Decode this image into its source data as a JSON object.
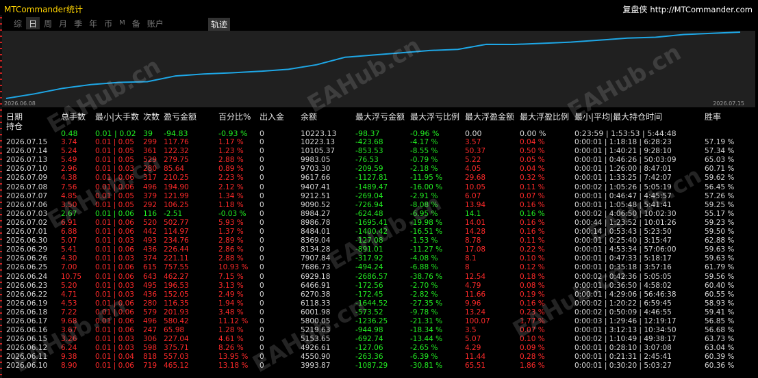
{
  "header": {
    "app_title": "MTCommander统计",
    "site_cn": "复盘侠",
    "site_url": "http://MTCommander.com"
  },
  "tabs": [
    {
      "label": "综",
      "active": false
    },
    {
      "label": "日",
      "active": true
    },
    {
      "label": "周",
      "active": false
    },
    {
      "label": "月",
      "active": false
    },
    {
      "label": "季",
      "active": false
    },
    {
      "label": "年",
      "active": false
    },
    {
      "label": "币",
      "active": false
    },
    {
      "label": "M",
      "active": false
    },
    {
      "label": "备",
      "active": false
    },
    {
      "label": "账户",
      "active": false
    }
  ],
  "track_button": "轨迹",
  "chart": {
    "start_date": "2026.06.08",
    "end_date": "2026.07.15",
    "line_color": "#1ea7e6"
  },
  "table": {
    "headers": {
      "date": "日期",
      "holding": "持仓",
      "total_lots": "总手数",
      "min_max_lots": "最小|大手数",
      "count": "次数",
      "pnl": "盈亏金额",
      "pct": "百分比%",
      "in_out": "出入金",
      "balance": "余额",
      "max_float_loss_amt": "最大浮亏金额",
      "max_float_loss_pct": "最大浮亏比例",
      "max_float_profit_amt": "最大浮盈金额",
      "max_float_profit_pct": "最大浮盈比例",
      "hold_time": "最小|平均|最大持仓时间",
      "win_rate": "胜率"
    },
    "holding_row": {
      "total": "0.48",
      "minmax": "0.01 | 0.02",
      "count": "39",
      "pnl": "-94.83",
      "pct": "-0.93 %",
      "io": "0",
      "balance": "10223.13",
      "maxlossamt": "-98.37",
      "maxlosspct": "-0.96 %",
      "maxprofamt": "0.00",
      "maxprofpct": "0.00 %",
      "hold": "0:23:59 | 1:53:53 | 5:44:48",
      "win": ""
    },
    "rows": [
      {
        "date": "2026.07.15",
        "total": "3.74",
        "minmax": "0.01 | 0.05",
        "count": "299",
        "pnl": "117.76",
        "pct": "1.17 %",
        "io": "0",
        "balance": "10223.13",
        "maxlossamt": "-423.68",
        "maxlosspct": "-4.17 %",
        "maxprofamt": "3.57",
        "maxprofpct": "0.04 %",
        "hold": "0:00:01 | 1:18:18 | 6:28:23",
        "win": "57.19 %"
      },
      {
        "date": "2026.07.14",
        "total": "5.24",
        "minmax": "0.01 | 0.05",
        "count": "361",
        "pnl": "122.32",
        "pct": "1.23 %",
        "io": "0",
        "balance": "10105.37",
        "maxlossamt": "-853.53",
        "maxlosspct": "-8.55 %",
        "maxprofamt": "50.37",
        "maxprofpct": "0.50 %",
        "hold": "0:00:01 | 1:40:21 | 9:28:10",
        "win": "57.34 %"
      },
      {
        "date": "2026.07.13",
        "total": "5.49",
        "minmax": "0.01 | 0.05",
        "count": "529",
        "pnl": "279.75",
        "pct": "2.88 %",
        "io": "0",
        "balance": "9983.05",
        "maxlossamt": "-76.53",
        "maxlosspct": "-0.79 %",
        "maxprofamt": "5.22",
        "maxprofpct": "0.05 %",
        "hold": "0:00:01 | 0:46:26 | 50:03:09",
        "win": "65.03 %"
      },
      {
        "date": "2026.07.10",
        "total": "2.96",
        "minmax": "0.01 | 0.03",
        "count": "280",
        "pnl": "85.64",
        "pct": "0.89 %",
        "io": "0",
        "balance": "9703.30",
        "maxlossamt": "-209.59",
        "maxlosspct": "-2.18 %",
        "maxprofamt": "4.05",
        "maxprofpct": "0.04 %",
        "hold": "0:00:01 | 1:26:00 | 8:47:01",
        "win": "60.71 %"
      },
      {
        "date": "2026.07.09",
        "total": "4.38",
        "minmax": "0.01 | 0.06",
        "count": "317",
        "pnl": "210.25",
        "pct": "2.23 %",
        "io": "0",
        "balance": "9617.66",
        "maxlossamt": "-1127.81",
        "maxlosspct": "-11.95 %",
        "maxprofamt": "29.68",
        "maxprofpct": "0.32 %",
        "hold": "0:00:01 | 1:33:25 | 7:42:07",
        "win": "59.62 %"
      },
      {
        "date": "2026.07.08",
        "total": "7.56",
        "minmax": "0.01 | 0.06",
        "count": "496",
        "pnl": "194.90",
        "pct": "2.12 %",
        "io": "0",
        "balance": "9407.41",
        "maxlossamt": "-1489.47",
        "maxlosspct": "-16.00 %",
        "maxprofamt": "10.05",
        "maxprofpct": "0.11 %",
        "hold": "0:00:02 | 1:05:26 | 5:05:19",
        "win": "56.45 %"
      },
      {
        "date": "2026.07.07",
        "total": "4.85",
        "minmax": "0.01 | 0.05",
        "count": "379",
        "pnl": "121.99",
        "pct": "1.34 %",
        "io": "0",
        "balance": "9212.51",
        "maxlossamt": "-269.04",
        "maxlosspct": "-2.91 %",
        "maxprofamt": "6.07",
        "maxprofpct": "0.07 %",
        "hold": "0:00:01 | 0:46:47 | 4:45:57",
        "win": "57.26 %"
      },
      {
        "date": "2026.07.06",
        "total": "3.50",
        "minmax": "0.01 | 0.05",
        "count": "292",
        "pnl": "106.25",
        "pct": "1.18 %",
        "io": "0",
        "balance": "9090.52",
        "maxlossamt": "-726.94",
        "maxlosspct": "-8.08 %",
        "maxprofamt": "13.94",
        "maxprofpct": "0.16 %",
        "hold": "0:00:01 | 1:05:48 | 5:41:41",
        "win": "59.25 %"
      },
      {
        "date": "2026.07.03",
        "total": "2.67",
        "minmax": "0.01 | 0.06",
        "count": "116",
        "pnl": "-2.51",
        "pct": "-0.03 %",
        "io": "0",
        "balance": "8984.27",
        "maxlossamt": "-624.48",
        "maxlosspct": "-6.95 %",
        "maxprofamt": "14.1",
        "maxprofpct": "0.16 %",
        "hold": "0:00:02 | 4:06:50 | 10:02:30",
        "win": "55.17 %"
      },
      {
        "date": "2026.07.02",
        "total": "6.91",
        "minmax": "0.01 | 0.06",
        "count": "520",
        "pnl": "502.77",
        "pct": "5.93 %",
        "io": "0",
        "balance": "8986.78",
        "maxlossamt": "-1695.41",
        "maxlosspct": "-19.98 %",
        "maxprofamt": "14.01",
        "maxprofpct": "0.16 %",
        "hold": "0:00:44 | 1:23:52 | 10:01:26",
        "win": "59.23 %"
      },
      {
        "date": "2026.07.01",
        "total": "6.88",
        "minmax": "0.01 | 0.06",
        "count": "442",
        "pnl": "114.97",
        "pct": "1.37 %",
        "io": "0",
        "balance": "8484.01",
        "maxlossamt": "-1400.42",
        "maxlosspct": "-16.51 %",
        "maxprofamt": "14.28",
        "maxprofpct": "0.16 %",
        "hold": "0:00:14 | 0:53:43 | 5:23:50",
        "win": "59.50 %"
      },
      {
        "date": "2026.06.30",
        "total": "5.07",
        "minmax": "0.01 | 0.03",
        "count": "493",
        "pnl": "234.76",
        "pct": "2.89 %",
        "io": "0",
        "balance": "8369.04",
        "maxlossamt": "-127.08",
        "maxlosspct": "-1.53 %",
        "maxprofamt": "8.78",
        "maxprofpct": "0.11 %",
        "hold": "0:00:01 | 0:25:40 | 3:15:47",
        "win": "62.88 %"
      },
      {
        "date": "2026.06.29",
        "total": "5.41",
        "minmax": "0.01 | 0.06",
        "count": "436",
        "pnl": "226.44",
        "pct": "2.86 %",
        "io": "0",
        "balance": "8134.28",
        "maxlossamt": "-891.01",
        "maxlosspct": "-11.27 %",
        "maxprofamt": "17.08",
        "maxprofpct": "0.22 %",
        "hold": "0:00:01 | 4:53:34 | 57:06:00",
        "win": "59.63 %"
      },
      {
        "date": "2026.06.26",
        "total": "4.30",
        "minmax": "0.01 | 0.03",
        "count": "374",
        "pnl": "221.11",
        "pct": "2.88 %",
        "io": "0",
        "balance": "7907.84",
        "maxlossamt": "-317.92",
        "maxlosspct": "-4.08 %",
        "maxprofamt": "8.1",
        "maxprofpct": "0.10 %",
        "hold": "0:00:01 | 0:47:33 | 5:18:17",
        "win": "59.63 %"
      },
      {
        "date": "2026.06.25",
        "total": "7.00",
        "minmax": "0.01 | 0.06",
        "count": "615",
        "pnl": "757.55",
        "pct": "10.93 %",
        "io": "0",
        "balance": "7686.73",
        "maxlossamt": "-494.24",
        "maxlosspct": "-6.88 %",
        "maxprofamt": "8",
        "maxprofpct": "0.12 %",
        "hold": "0:00:01 | 0:35:18 | 3:57:16",
        "win": "61.79 %"
      },
      {
        "date": "2026.06.24",
        "total": "10.75",
        "minmax": "0.01 | 0.06",
        "count": "643",
        "pnl": "462.27",
        "pct": "7.15 %",
        "io": "0",
        "balance": "6929.18",
        "maxlossamt": "-2686.57",
        "maxlosspct": "-38.76 %",
        "maxprofamt": "12.54",
        "maxprofpct": "0.18 %",
        "hold": "0:00:02 | 0:42:36 | 5:05:05",
        "win": "59.56 %"
      },
      {
        "date": "2026.06.23",
        "total": "5.20",
        "minmax": "0.01 | 0.03",
        "count": "495",
        "pnl": "196.53",
        "pct": "3.13 %",
        "io": "0",
        "balance": "6466.91",
        "maxlossamt": "-172.56",
        "maxlosspct": "-2.70 %",
        "maxprofamt": "4.79",
        "maxprofpct": "0.08 %",
        "hold": "0:00:01 | 0:36:50 | 4:58:02",
        "win": "60.40 %"
      },
      {
        "date": "2026.06.22",
        "total": "4.71",
        "minmax": "0.01 | 0.03",
        "count": "436",
        "pnl": "152.05",
        "pct": "2.49 %",
        "io": "0",
        "balance": "6270.38",
        "maxlossamt": "-172.45",
        "maxlosspct": "-2.82 %",
        "maxprofamt": "11.66",
        "maxprofpct": "0.19 %",
        "hold": "0:00:01 | 4:29:06 | 56:46:38",
        "win": "60.55 %"
      },
      {
        "date": "2026.06.19",
        "total": "4.53",
        "minmax": "0.01 | 0.06",
        "count": "280",
        "pnl": "116.35",
        "pct": "1.94 %",
        "io": "0",
        "balance": "6118.33",
        "maxlossamt": "-1644.52",
        "maxlosspct": "-27.35 %",
        "maxprofamt": "9.96",
        "maxprofpct": "0.16 %",
        "hold": "0:00:02 | 1:20:22 | 6:59:45",
        "win": "58.93 %"
      },
      {
        "date": "2026.06.18",
        "total": "7.22",
        "minmax": "0.01 | 0.06",
        "count": "579",
        "pnl": "201.93",
        "pct": "3.48 %",
        "io": "0",
        "balance": "6001.98",
        "maxlossamt": "-573.52",
        "maxlosspct": "-9.78 %",
        "maxprofamt": "13.24",
        "maxprofpct": "0.23 %",
        "hold": "0:00:02 | 0:50:09 | 4:46:55",
        "win": "59.41 %"
      },
      {
        "date": "2026.06.17",
        "total": "9.68",
        "minmax": "0.01 | 0.06",
        "count": "496",
        "pnl": "580.42",
        "pct": "11.12 %",
        "io": "0",
        "balance": "5800.05",
        "maxlossamt": "-1236.25",
        "maxlosspct": "-21.31 %",
        "maxprofamt": "100.07",
        "maxprofpct": "1.77 %",
        "hold": "0:00:03 | 1:29:46 | 12:19:17",
        "win": "56.85 %"
      },
      {
        "date": "2026.06.16",
        "total": "3.67",
        "minmax": "0.01 | 0.06",
        "count": "247",
        "pnl": "65.98",
        "pct": "1.28 %",
        "io": "0",
        "balance": "5219.63",
        "maxlossamt": "-944.98",
        "maxlosspct": "-18.34 %",
        "maxprofamt": "3.5",
        "maxprofpct": "0.07 %",
        "hold": "0:00:01 | 3:12:13 | 10:34:50",
        "win": "56.68 %"
      },
      {
        "date": "2026.06.15",
        "total": "3.26",
        "minmax": "0.01 | 0.03",
        "count": "306",
        "pnl": "227.04",
        "pct": "4.61 %",
        "io": "0",
        "balance": "5153.65",
        "maxlossamt": "-692.74",
        "maxlosspct": "-13.44 %",
        "maxprofamt": "5.07",
        "maxprofpct": "0.10 %",
        "hold": "0:00:02 | 1:10:49 | 49:38:17",
        "win": "63.73 %"
      },
      {
        "date": "2026.06.12",
        "total": "6.24",
        "minmax": "0.01 | 0.03",
        "count": "598",
        "pnl": "375.71",
        "pct": "8.26 %",
        "io": "0",
        "balance": "4926.61",
        "maxlossamt": "-127.06",
        "maxlosspct": "-2.65 %",
        "maxprofamt": "4.29",
        "maxprofpct": "0.09 %",
        "hold": "0:00:01 | 0:28:10 | 3:07:08",
        "win": "63.04 %"
      },
      {
        "date": "2026.06.11",
        "total": "9.38",
        "minmax": "0.01 | 0.04",
        "count": "818",
        "pnl": "557.03",
        "pct": "13.95 %",
        "io": "0",
        "balance": "4550.90",
        "maxlossamt": "-263.36",
        "maxlosspct": "-6.39 %",
        "maxprofamt": "11.44",
        "maxprofpct": "0.28 %",
        "hold": "0:00:01 | 0:21:31 | 2:45:41",
        "win": "60.39 %"
      },
      {
        "date": "2026.06.10",
        "total": "8.90",
        "minmax": "0.01 | 0.06",
        "count": "719",
        "pnl": "465.12",
        "pct": "13.18 %",
        "io": "0",
        "balance": "3993.87",
        "maxlossamt": "-1087.29",
        "maxlosspct": "-30.81 %",
        "maxprofamt": "65.51",
        "maxprofpct": "1.86 %",
        "hold": "0:00:01 | 0:30:20 | 5:03:27",
        "win": "60.36 %"
      }
    ]
  },
  "watermarks": [
    "EAHub.cn",
    "EAHub.cn",
    "EAHub.cn",
    "EAHub.cn",
    "EAHub.cn",
    "EAHub.cn",
    "EAHub.cn",
    "EAHub.cn",
    "EAHub.cn"
  ]
}
